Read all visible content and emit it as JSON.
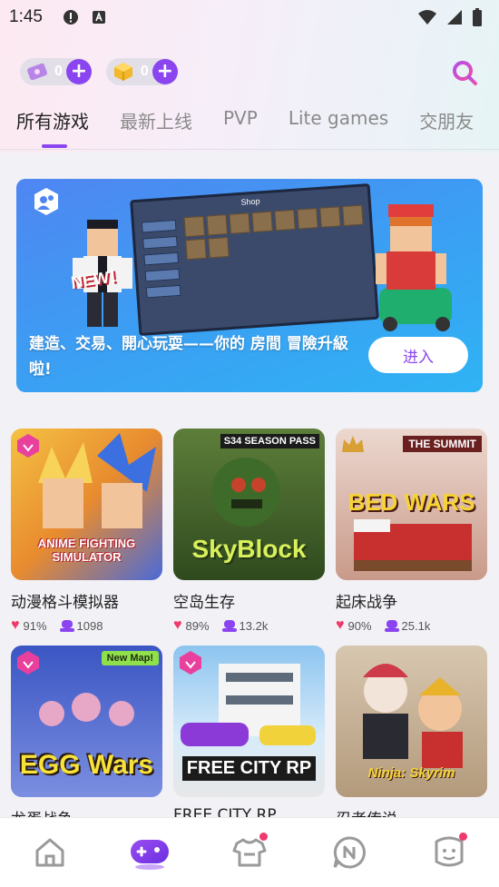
{
  "status_bar": {
    "time": "1:45"
  },
  "currency": [
    {
      "name": "gem-ticket",
      "count": "0",
      "color": "#b785e8"
    },
    {
      "name": "gold-cube",
      "count": "0",
      "color": "#f2b72a"
    }
  ],
  "tabs": [
    {
      "label": "所有游戏",
      "active": true
    },
    {
      "label": "最新上线",
      "active": false
    },
    {
      "label": "PVP",
      "active": false
    },
    {
      "label": "Lite games",
      "active": false
    },
    {
      "label": "交朋友",
      "active": false
    }
  ],
  "banner": {
    "shop_title": "Shop",
    "new_label": "NEW！",
    "text": "建造、交易、開心玩耍——你的 房間 冒險升級啦!",
    "button": "进入"
  },
  "games": [
    {
      "name": "动漫格斗模拟器",
      "rating": "91%",
      "players": "1098",
      "art": "ANIME FIGHTING SIMULATOR",
      "bg": "#e8a93a",
      "badge": true
    },
    {
      "name": "空岛生存",
      "rating": "89%",
      "players": "13.2k",
      "art": "SkyBlock",
      "art_top": "S34 SEASON PASS",
      "bg": "#3c5a26",
      "badge": false
    },
    {
      "name": "起床战争",
      "rating": "90%",
      "players": "25.1k",
      "art": "BED WARS",
      "art_top": "THE SUMMIT",
      "bg": "#d8c2b8",
      "badge": false
    },
    {
      "name": "龙蛋战争",
      "rating": "",
      "players": "",
      "art": "EGG Wars",
      "art_top": "New Map!",
      "bg": "#4a63c9",
      "badge": true
    },
    {
      "name": "FREE CITY RP",
      "rating": "",
      "players": "",
      "art": "FREE CITY RP",
      "bg": "#7fb8ea",
      "badge": true
    },
    {
      "name": "忍者传说",
      "rating": "",
      "players": "",
      "art": "Ninja: Skyrim",
      "bg": "#c9b49a",
      "badge": false
    }
  ],
  "bottom_nav": [
    {
      "name": "home",
      "active": false,
      "dot": false
    },
    {
      "name": "games",
      "active": true,
      "dot": false
    },
    {
      "name": "shop",
      "active": false,
      "dot": true
    },
    {
      "name": "news",
      "active": false,
      "dot": false
    },
    {
      "name": "profile",
      "active": false,
      "dot": true
    }
  ],
  "colors": {
    "accent": "#8b45f0",
    "heart": "#f0386b",
    "banner": "#3aa0f3"
  }
}
